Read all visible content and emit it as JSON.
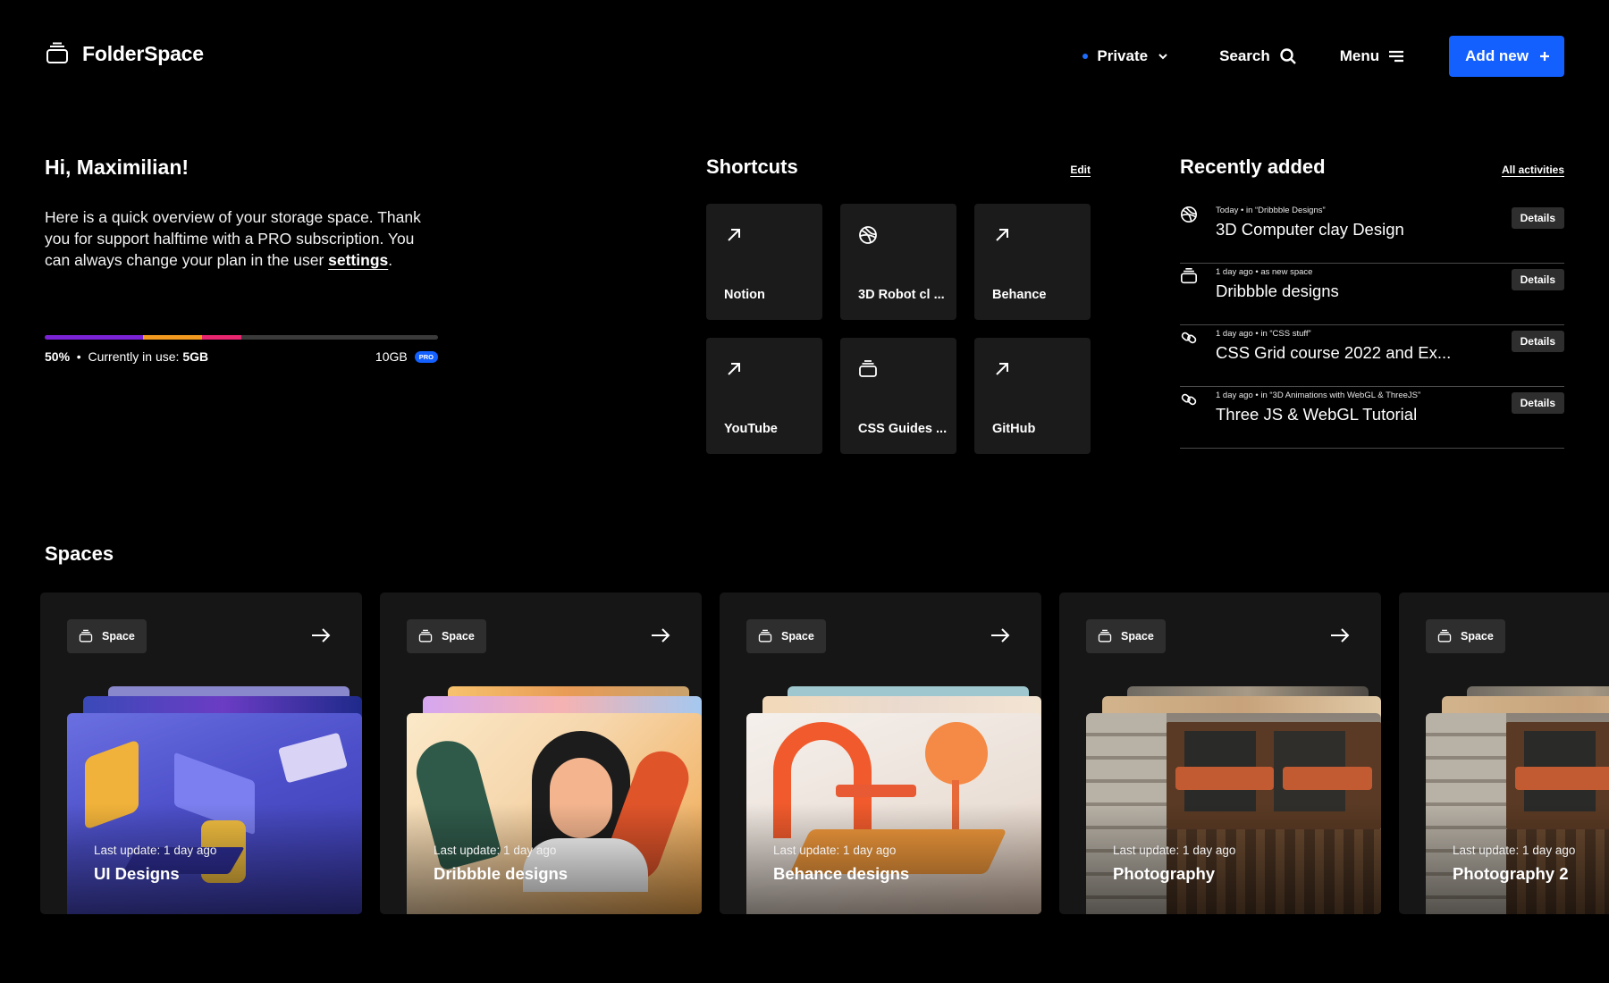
{
  "header": {
    "app_name": "FolderSpace",
    "privacy_label": "Private",
    "search_label": "Search",
    "menu_label": "Menu",
    "add_label": "Add new"
  },
  "greeting": {
    "title": "Hi, Maximilian!",
    "text_before": "Here is a quick overview of your storage space. Thank you for support halftime with a PRO subscription. You can always change your plan in the user ",
    "settings_link": "settings",
    "text_after": "."
  },
  "storage": {
    "percent_label": "50%",
    "in_use_label": "Currently in use:",
    "in_use_value": "5GB",
    "capacity": "10GB",
    "plan_badge": "PRO",
    "used_fraction": 0.5,
    "segments": [
      {
        "fraction": 0.25,
        "color": "#7a22d6"
      },
      {
        "fraction": 0.15,
        "color": "#f29a1f"
      },
      {
        "fraction": 0.1,
        "color": "#e8266f"
      }
    ]
  },
  "shortcuts": {
    "title": "Shortcuts",
    "edit_label": "Edit",
    "items": [
      {
        "label": "Notion",
        "icon": "arrow-up-right-icon"
      },
      {
        "label": "3D Robot cl ...",
        "icon": "dribbble-icon"
      },
      {
        "label": "Behance",
        "icon": "arrow-up-right-icon"
      },
      {
        "label": "YouTube",
        "icon": "arrow-up-right-icon"
      },
      {
        "label": "CSS Guides ...",
        "icon": "folder-stack-icon"
      },
      {
        "label": "GitHub",
        "icon": "arrow-up-right-icon"
      }
    ]
  },
  "recent": {
    "title": "Recently added",
    "all_label": "All activities",
    "details_label": "Details",
    "items": [
      {
        "meta": "Today  •  in “Dribbble Designs”",
        "title": "3D Computer clay Design",
        "icon": "dribbble-icon"
      },
      {
        "meta": "1 day ago •  as new space",
        "title": "Dribbble designs",
        "icon": "folder-stack-icon"
      },
      {
        "meta": "1 day ago  •  in “CSS stuff”",
        "title": "CSS Grid course 2022 and Ex...",
        "icon": "link-icon"
      },
      {
        "meta": "1 day ago  •  in “3D Animations with WebGL & ThreeJS”",
        "title": "Three JS & WebGL Tutorial",
        "icon": "link-icon"
      }
    ]
  },
  "spaces": {
    "title": "Spaces",
    "badge_label": "Space",
    "items": [
      {
        "name": "UI Designs",
        "updated": "Last update: 1 day ago",
        "theme": "isometric"
      },
      {
        "name": "Dribbble designs",
        "updated": "Last update: 1 day ago",
        "theme": "illustration"
      },
      {
        "name": "Behance designs",
        "updated": "Last update: 1 day ago",
        "theme": "clay"
      },
      {
        "name": "Photography",
        "updated": "Last update: 1 day ago",
        "theme": "photo"
      },
      {
        "name": "Photography 2",
        "updated": "Last update: 1 day ago",
        "theme": "photo"
      }
    ]
  },
  "colors": {
    "accent": "#1360ff",
    "tile_bg": "#1b1b1b",
    "card_bg": "#161616"
  }
}
